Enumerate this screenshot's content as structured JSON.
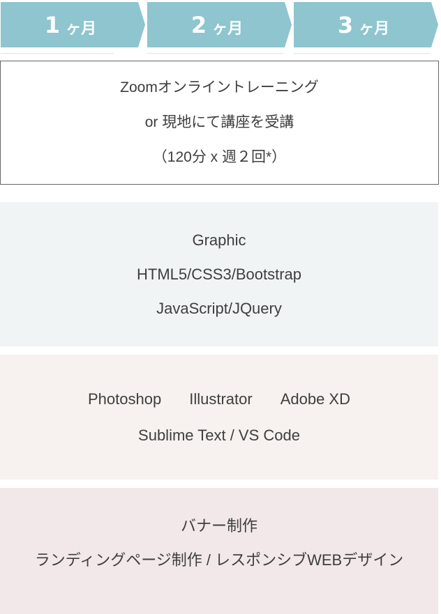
{
  "colors": {
    "step_fill": "#8ec5ce",
    "step_line": "#cfe6ea",
    "panel_skills_bg": "#f1f4f5",
    "panel_tools_bg": "#f7f2ef",
    "panel_projects_bg": "#f2e8ea",
    "text": "#3e3e3e"
  },
  "steps": [
    {
      "number": "1",
      "unit": "ヶ月"
    },
    {
      "number": "2",
      "unit": "ヶ月"
    },
    {
      "number": "3",
      "unit": "ヶ月"
    }
  ],
  "training": {
    "lines": [
      "Zoomオンライントレーニング",
      "or  現地にて講座を受講",
      "（120分 x 週２回*）"
    ]
  },
  "skills": {
    "lines": [
      "Graphic",
      "HTML5/CSS3/Bootstrap",
      "JavaScript/JQuery"
    ]
  },
  "tools": {
    "row1": [
      "Photoshop",
      "Illustrator",
      "Adobe XD"
    ],
    "row2": "Sublime Text / VS Code"
  },
  "projects": {
    "lines": [
      "バナー制作",
      "ランディングページ制作 / レスポンシブWEBデザイン"
    ]
  }
}
